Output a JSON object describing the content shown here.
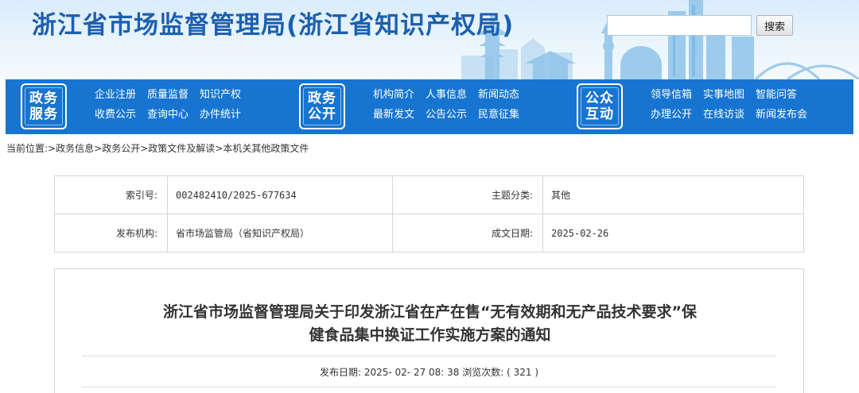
{
  "header": {
    "site_title": "浙江省市场监督管理局(浙江省知识产权局)",
    "search_placeholder": "",
    "search_button": "搜索"
  },
  "nav": {
    "groups": [
      {
        "badge": [
          "政务",
          "服务"
        ],
        "links": [
          "企业注册",
          "质量监督",
          "知识产权",
          "收费公示",
          "查询中心",
          "办件统计"
        ]
      },
      {
        "badge": [
          "政务",
          "公开"
        ],
        "links": [
          "机构简介",
          "人事信息",
          "新闻动态",
          "最新发文",
          "公告公示",
          "民意征集"
        ]
      },
      {
        "badge": [
          "公众",
          "互动"
        ],
        "links": [
          "领导信箱",
          "实事地图",
          "智能问答",
          "办理公开",
          "在线访谈",
          "新闻发布会"
        ]
      }
    ]
  },
  "breadcrumb": {
    "prefix": "当前位置:",
    "items": [
      "政务信息",
      "政务公开",
      "政策文件及解读",
      "本机关其他政策文件"
    ]
  },
  "meta": {
    "index_label": "索引号:",
    "index_value": "002482410/2025-677634",
    "topic_label": "主题分类:",
    "topic_value": "其他",
    "publisher_label": "发布机构:",
    "publisher_value": "省市场监管局（省知识产权局）",
    "date_label": "成文日期:",
    "date_value": "2025-02-26"
  },
  "article": {
    "title_line1": "浙江省市场监督管理局关于印发浙江省在产在售“无有效期和无产品技术要求”保",
    "title_line2": "健食品集中换证工作实施方案的通知",
    "publish_label": "发布日期:",
    "publish_value": "2025- 02- 27 08: 38",
    "views_label": "浏览次数:",
    "views_value": "( 321 )"
  },
  "colors": {
    "title_blue": "#1d5fae",
    "nav_blue": "#1775d1"
  }
}
